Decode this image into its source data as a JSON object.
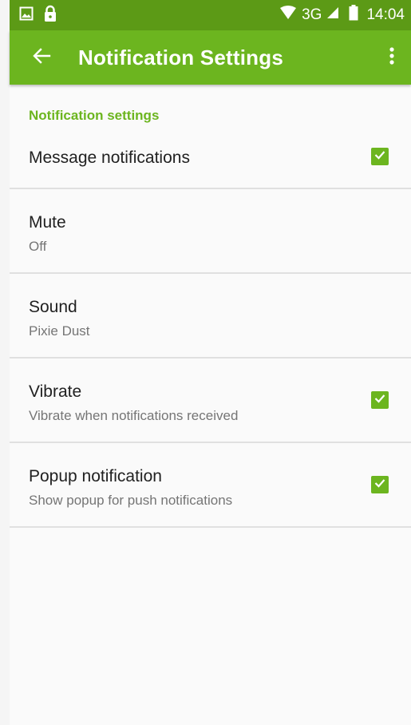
{
  "status_bar": {
    "network": "3G",
    "time": "14:04"
  },
  "app_bar": {
    "title": "Notification Settings"
  },
  "section": {
    "header": "Notification settings"
  },
  "preferences": [
    {
      "title": "Message notifications",
      "summary": "",
      "checked": true
    },
    {
      "title": "Mute",
      "summary": "Off"
    },
    {
      "title": "Sound",
      "summary": "Pixie Dust"
    },
    {
      "title": "Vibrate",
      "summary": "Vibrate when notifications received",
      "checked": true
    },
    {
      "title": "Popup notification",
      "summary": "Show popup for push notifications",
      "checked": true
    }
  ],
  "colors": {
    "accent": "#6cb51f",
    "status_bar": "#5c9a16"
  }
}
